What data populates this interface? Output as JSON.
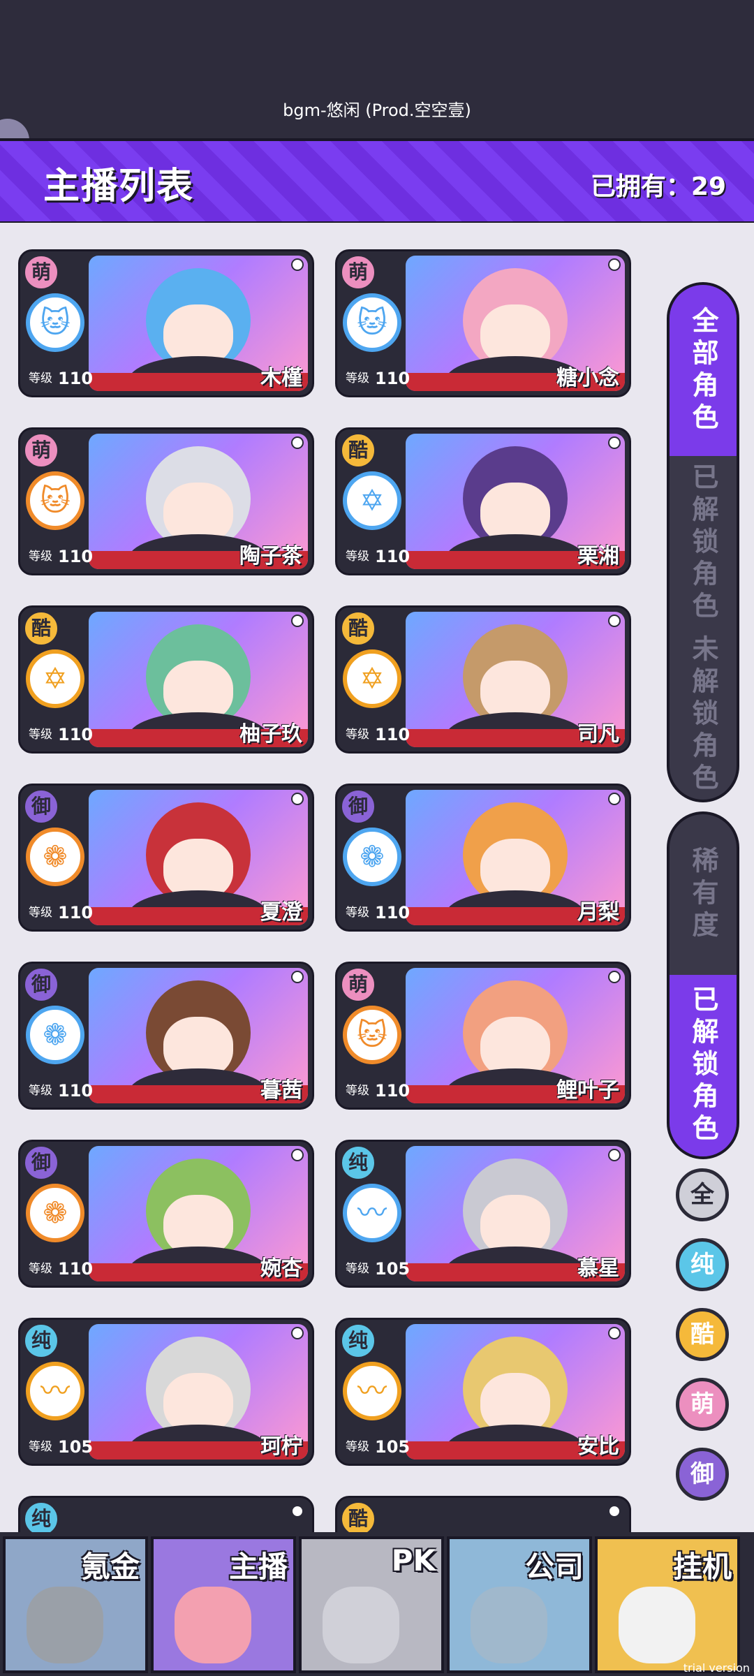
{
  "bgm_text": "bgm-悠闲 (Prod.空空壹)",
  "header": {
    "title": "主播列表",
    "owned": "已拥有：29"
  },
  "level_label": "等级",
  "cards": [
    {
      "tag": "萌",
      "tag_color": "#ec8fbf",
      "icon": "cat-icon",
      "icon_glyph": "🐱",
      "icon_color": "#4ea6f0",
      "level": "110",
      "name": "木槿",
      "hair": "#5ab0f0"
    },
    {
      "tag": "萌",
      "tag_color": "#ec8fbf",
      "icon": "cat-icon",
      "icon_glyph": "🐱",
      "icon_color": "#4ea6f0",
      "level": "110",
      "name": "糖小念",
      "hair": "#f3a7c2"
    },
    {
      "tag": "萌",
      "tag_color": "#ec8fbf",
      "icon": "cat-icon",
      "icon_glyph": "🐱",
      "icon_color": "#f08b2a",
      "level": "110",
      "name": "陶子茶",
      "hair": "#dcdde6"
    },
    {
      "tag": "酷",
      "tag_color": "#f5b93a",
      "icon": "star-icon",
      "icon_glyph": "✡",
      "icon_color": "#4ea6f0",
      "level": "110",
      "name": "栗湘",
      "hair": "#5a3c8c"
    },
    {
      "tag": "酷",
      "tag_color": "#f5b93a",
      "icon": "star-icon",
      "icon_glyph": "✡",
      "icon_color": "#f0a020",
      "level": "110",
      "name": "柚子玖",
      "hair": "#6cbf9c"
    },
    {
      "tag": "酷",
      "tag_color": "#f5b93a",
      "icon": "star-icon",
      "icon_glyph": "✡",
      "icon_color": "#f0a020",
      "level": "110",
      "name": "司凡",
      "hair": "#c59a6a"
    },
    {
      "tag": "御",
      "tag_color": "#8a63d6",
      "icon": "rose-icon",
      "icon_glyph": "❁",
      "icon_color": "#f08b2a",
      "level": "110",
      "name": "夏澄",
      "hair": "#c8323a"
    },
    {
      "tag": "御",
      "tag_color": "#8a63d6",
      "icon": "rose-icon",
      "icon_glyph": "❁",
      "icon_color": "#4ea6f0",
      "level": "110",
      "name": "月梨",
      "hair": "#f0a04a"
    },
    {
      "tag": "御",
      "tag_color": "#8a63d6",
      "icon": "rose-icon",
      "icon_glyph": "❁",
      "icon_color": "#4ea6f0",
      "level": "110",
      "name": "暮茜",
      "hair": "#7a4a34"
    },
    {
      "tag": "萌",
      "tag_color": "#ec8fbf",
      "icon": "cat-icon",
      "icon_glyph": "🐱",
      "icon_color": "#f08b2a",
      "level": "110",
      "name": "鲤叶子",
      "hair": "#f2a080"
    },
    {
      "tag": "御",
      "tag_color": "#8a63d6",
      "icon": "rose-icon",
      "icon_glyph": "❁",
      "icon_color": "#f08b2a",
      "level": "110",
      "name": "婉杏",
      "hair": "#8cc060"
    },
    {
      "tag": "纯",
      "tag_color": "#5bc6e8",
      "icon": "pulse-icon",
      "icon_glyph": "〰",
      "icon_color": "#4ea6f0",
      "level": "105",
      "name": "慕星",
      "hair": "#c9c9d2"
    },
    {
      "tag": "纯",
      "tag_color": "#5bc6e8",
      "icon": "pulse-icon",
      "icon_glyph": "〰",
      "icon_color": "#f0a020",
      "level": "105",
      "name": "珂柠",
      "hair": "#d8d8d8"
    },
    {
      "tag": "纯",
      "tag_color": "#5bc6e8",
      "icon": "pulse-icon",
      "icon_glyph": "〰",
      "icon_color": "#f0a020",
      "level": "105",
      "name": "安比",
      "hair": "#e8c870"
    }
  ],
  "partial_row_tags": [
    {
      "tag": "纯",
      "tag_color": "#5bc6e8"
    },
    {
      "tag": "酷",
      "tag_color": "#f5b93a"
    }
  ],
  "side_menu_1": {
    "items": [
      "全部角色",
      "已解锁角色",
      "未解锁角色"
    ],
    "active": 0
  },
  "side_menu_2": {
    "items": [
      "稀有度",
      "已解锁角色"
    ],
    "active": 1
  },
  "filters": [
    {
      "label": "全",
      "color": "#cfcfd8"
    },
    {
      "label": "纯",
      "color": "#5bc6e8"
    },
    {
      "label": "酷",
      "color": "#f5b93a"
    },
    {
      "label": "萌",
      "color": "#ec8fbf"
    },
    {
      "label": "御",
      "color": "#8a63d6"
    }
  ],
  "bottom_tabs": [
    {
      "label": "氪金",
      "color": "#8fa7c8",
      "icon_color": "#9aa0a8"
    },
    {
      "label": "主播",
      "color": "#9a78e0",
      "icon_color": "#f3a0b0"
    },
    {
      "label": "PK",
      "color": "#b8b8c2",
      "icon_color": "#d0d0d8"
    },
    {
      "label": "公司",
      "color": "#8fb8d8",
      "icon_color": "#a0b8cc"
    },
    {
      "label": "挂机",
      "color": "#f0c050",
      "icon_color": "#f2f2f2"
    }
  ],
  "trial_text": "trial version"
}
